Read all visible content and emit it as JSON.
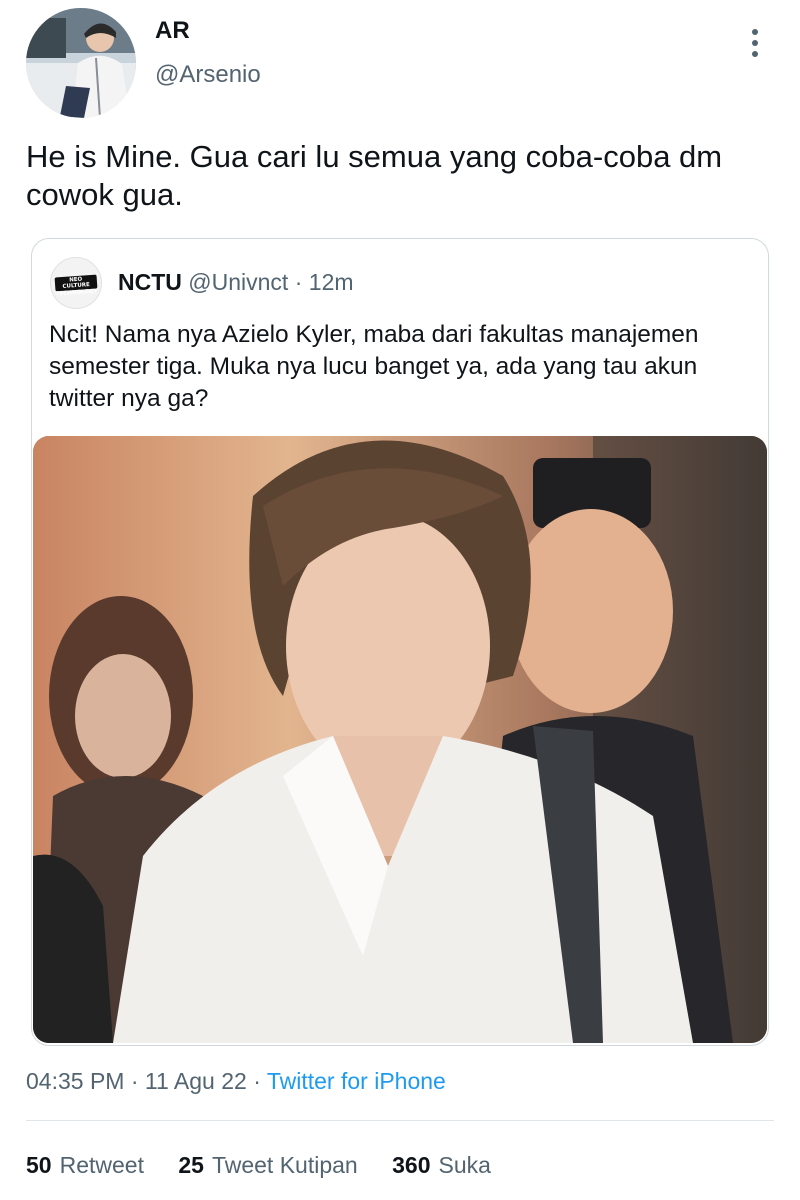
{
  "author": {
    "display_name": "AR",
    "handle": "@Arsenio"
  },
  "tweet": {
    "text": "He is Mine. Gua cari lu semua yang coba-coba dm cowok gua."
  },
  "quoted_tweet": {
    "avatar_logo_text": "NEO CULTURE TECHNOLOGY",
    "display_name": "NCTU",
    "handle": "@Univnct",
    "separator": "·",
    "time_ago": "12m",
    "text": "Ncit! Nama nya Azielo Kyler, maba dari fakultas manajemen semester tiga. Muka nya lucu banget ya, ada yang tau akun twitter nya ga?"
  },
  "meta": {
    "time": "04:35 PM",
    "separator": "·",
    "date": "11 Agu 22",
    "source": "Twitter for iPhone"
  },
  "stats": {
    "retweets_count": "50",
    "retweets_label": "Retweet",
    "quotes_count": "25",
    "quotes_label": "Tweet Kutipan",
    "likes_count": "360",
    "likes_label": "Suka"
  },
  "colors": {
    "link": "#1d9bf0",
    "muted_text": "#536471",
    "primary_text": "#0f1419",
    "border": "#cfd9de"
  }
}
